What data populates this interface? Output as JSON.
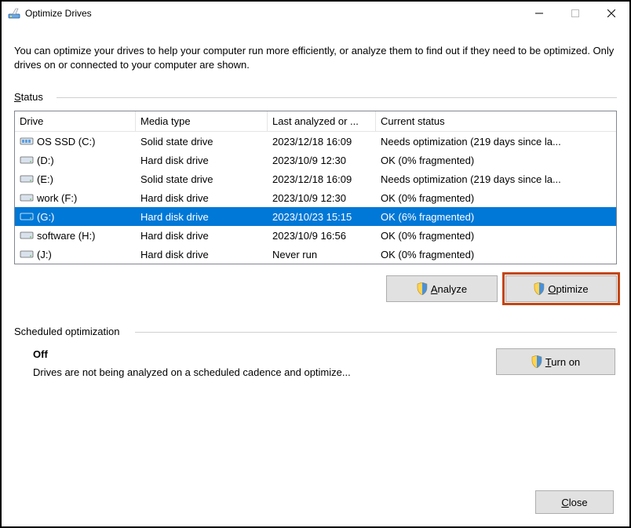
{
  "window": {
    "title": "Optimize Drives",
    "intro": "You can optimize your drives to help your computer run more efficiently, or analyze them to find out if they need to be optimized. Only drives on or connected to your computer are shown."
  },
  "status": {
    "label_prefix": "S",
    "label_rest": "tatus",
    "columns": {
      "drive": "Drive",
      "media": "Media type",
      "last": "Last analyzed or ...",
      "status": "Current status"
    },
    "rows": [
      {
        "icon": "ssd",
        "name": "OS SSD (C:)",
        "media": "Solid state drive",
        "last": "2023/12/18 16:09",
        "status": "Needs optimization (219 days since la...",
        "selected": false
      },
      {
        "icon": "hdd",
        "name": "(D:)",
        "media": "Hard disk drive",
        "last": "2023/10/9 12:30",
        "status": "OK (0% fragmented)",
        "selected": false
      },
      {
        "icon": "hdd",
        "name": "(E:)",
        "media": "Solid state drive",
        "last": "2023/12/18 16:09",
        "status": "Needs optimization (219 days since la...",
        "selected": false
      },
      {
        "icon": "hdd",
        "name": "work (F:)",
        "media": "Hard disk drive",
        "last": "2023/10/9 12:30",
        "status": "OK (0% fragmented)",
        "selected": false
      },
      {
        "icon": "hdd",
        "name": "(G:)",
        "media": "Hard disk drive",
        "last": "2023/10/23 15:15",
        "status": "OK (6% fragmented)",
        "selected": true
      },
      {
        "icon": "hdd",
        "name": "software (H:)",
        "media": "Hard disk drive",
        "last": "2023/10/9 16:56",
        "status": "OK (0% fragmented)",
        "selected": false
      },
      {
        "icon": "hdd",
        "name": "(J:)",
        "media": "Hard disk drive",
        "last": "Never run",
        "status": "OK (0% fragmented)",
        "selected": false
      }
    ],
    "buttons": {
      "analyze_prefix": "A",
      "analyze_rest": "nalyze",
      "optimize_prefix": "O",
      "optimize_rest": "ptimize"
    }
  },
  "scheduled": {
    "label": "Scheduled optimization",
    "state": "Off",
    "desc": "Drives are not being analyzed on a scheduled cadence and optimize...",
    "turnon_prefix": "T",
    "turnon_rest": "urn on"
  },
  "footer": {
    "close_prefix": "C",
    "close_rest": "lose"
  }
}
